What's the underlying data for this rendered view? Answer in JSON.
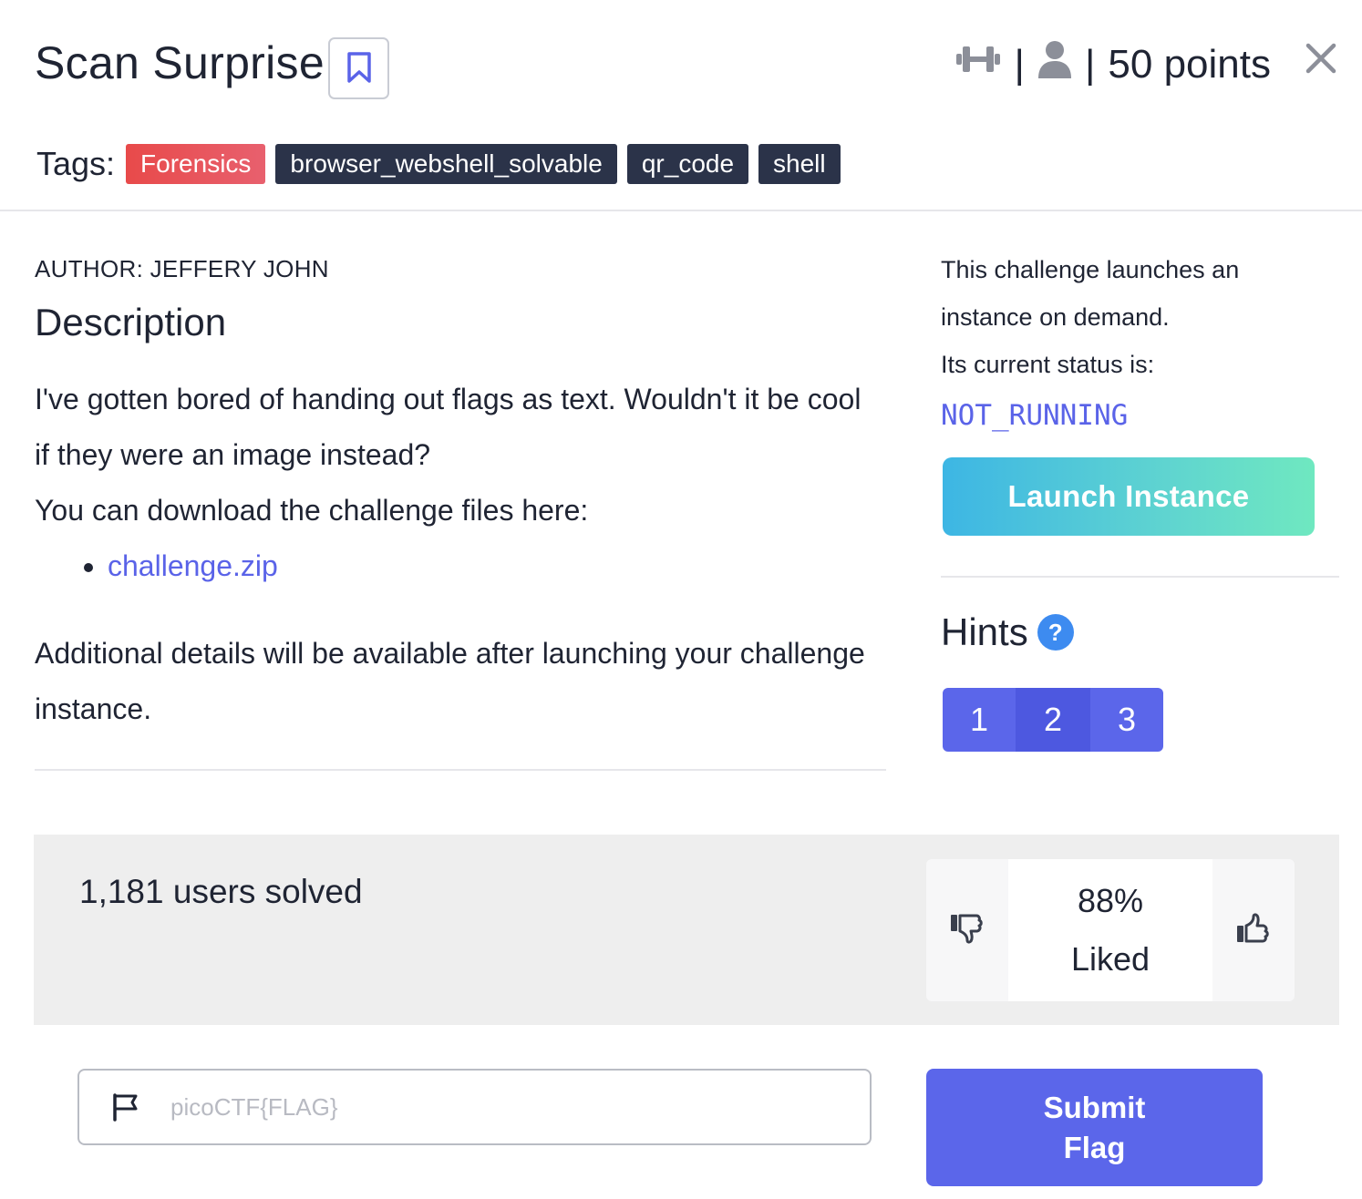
{
  "challenge": {
    "title": "Scan Surprise",
    "points": "50 points",
    "separator": "|",
    "close_icon": "close-icon",
    "bookmark_icon": "bookmark-icon"
  },
  "tags": {
    "label": "Tags:",
    "items": [
      "Forensics",
      "browser_webshell_solvable",
      "qr_code",
      "shell"
    ],
    "category_color": "#e84a4a",
    "tag_color": "#2b3349"
  },
  "description": {
    "author": "AUTHOR: JEFFERY JOHN",
    "heading": "Description",
    "paragraph1": "I've gotten bored of handing out flags as text. Wouldn't it be cool if they were an image instead?",
    "paragraph2": "You can download the challenge files here:",
    "file_link": "challenge.zip",
    "paragraph3": "Additional details will be available after launching your challenge instance."
  },
  "instance": {
    "line1": "This challenge launches an instance on demand.",
    "line2": "Its current status is:",
    "status": "NOT_RUNNING",
    "launch_label": "Launch Instance"
  },
  "hints": {
    "heading": "Hints",
    "help_symbol": "?",
    "buttons": [
      "1",
      "2",
      "3"
    ]
  },
  "stats": {
    "solved": "1,181 users solved",
    "liked_percent": "88%",
    "liked_label": "Liked"
  },
  "flag_form": {
    "placeholder": "picoCTF{FLAG}",
    "value": "",
    "submit_line1": "Submit",
    "submit_line2": "Flag"
  },
  "colors": {
    "accent": "#5b66ea",
    "link": "#5a63e8",
    "help": "#3d8bf0"
  }
}
